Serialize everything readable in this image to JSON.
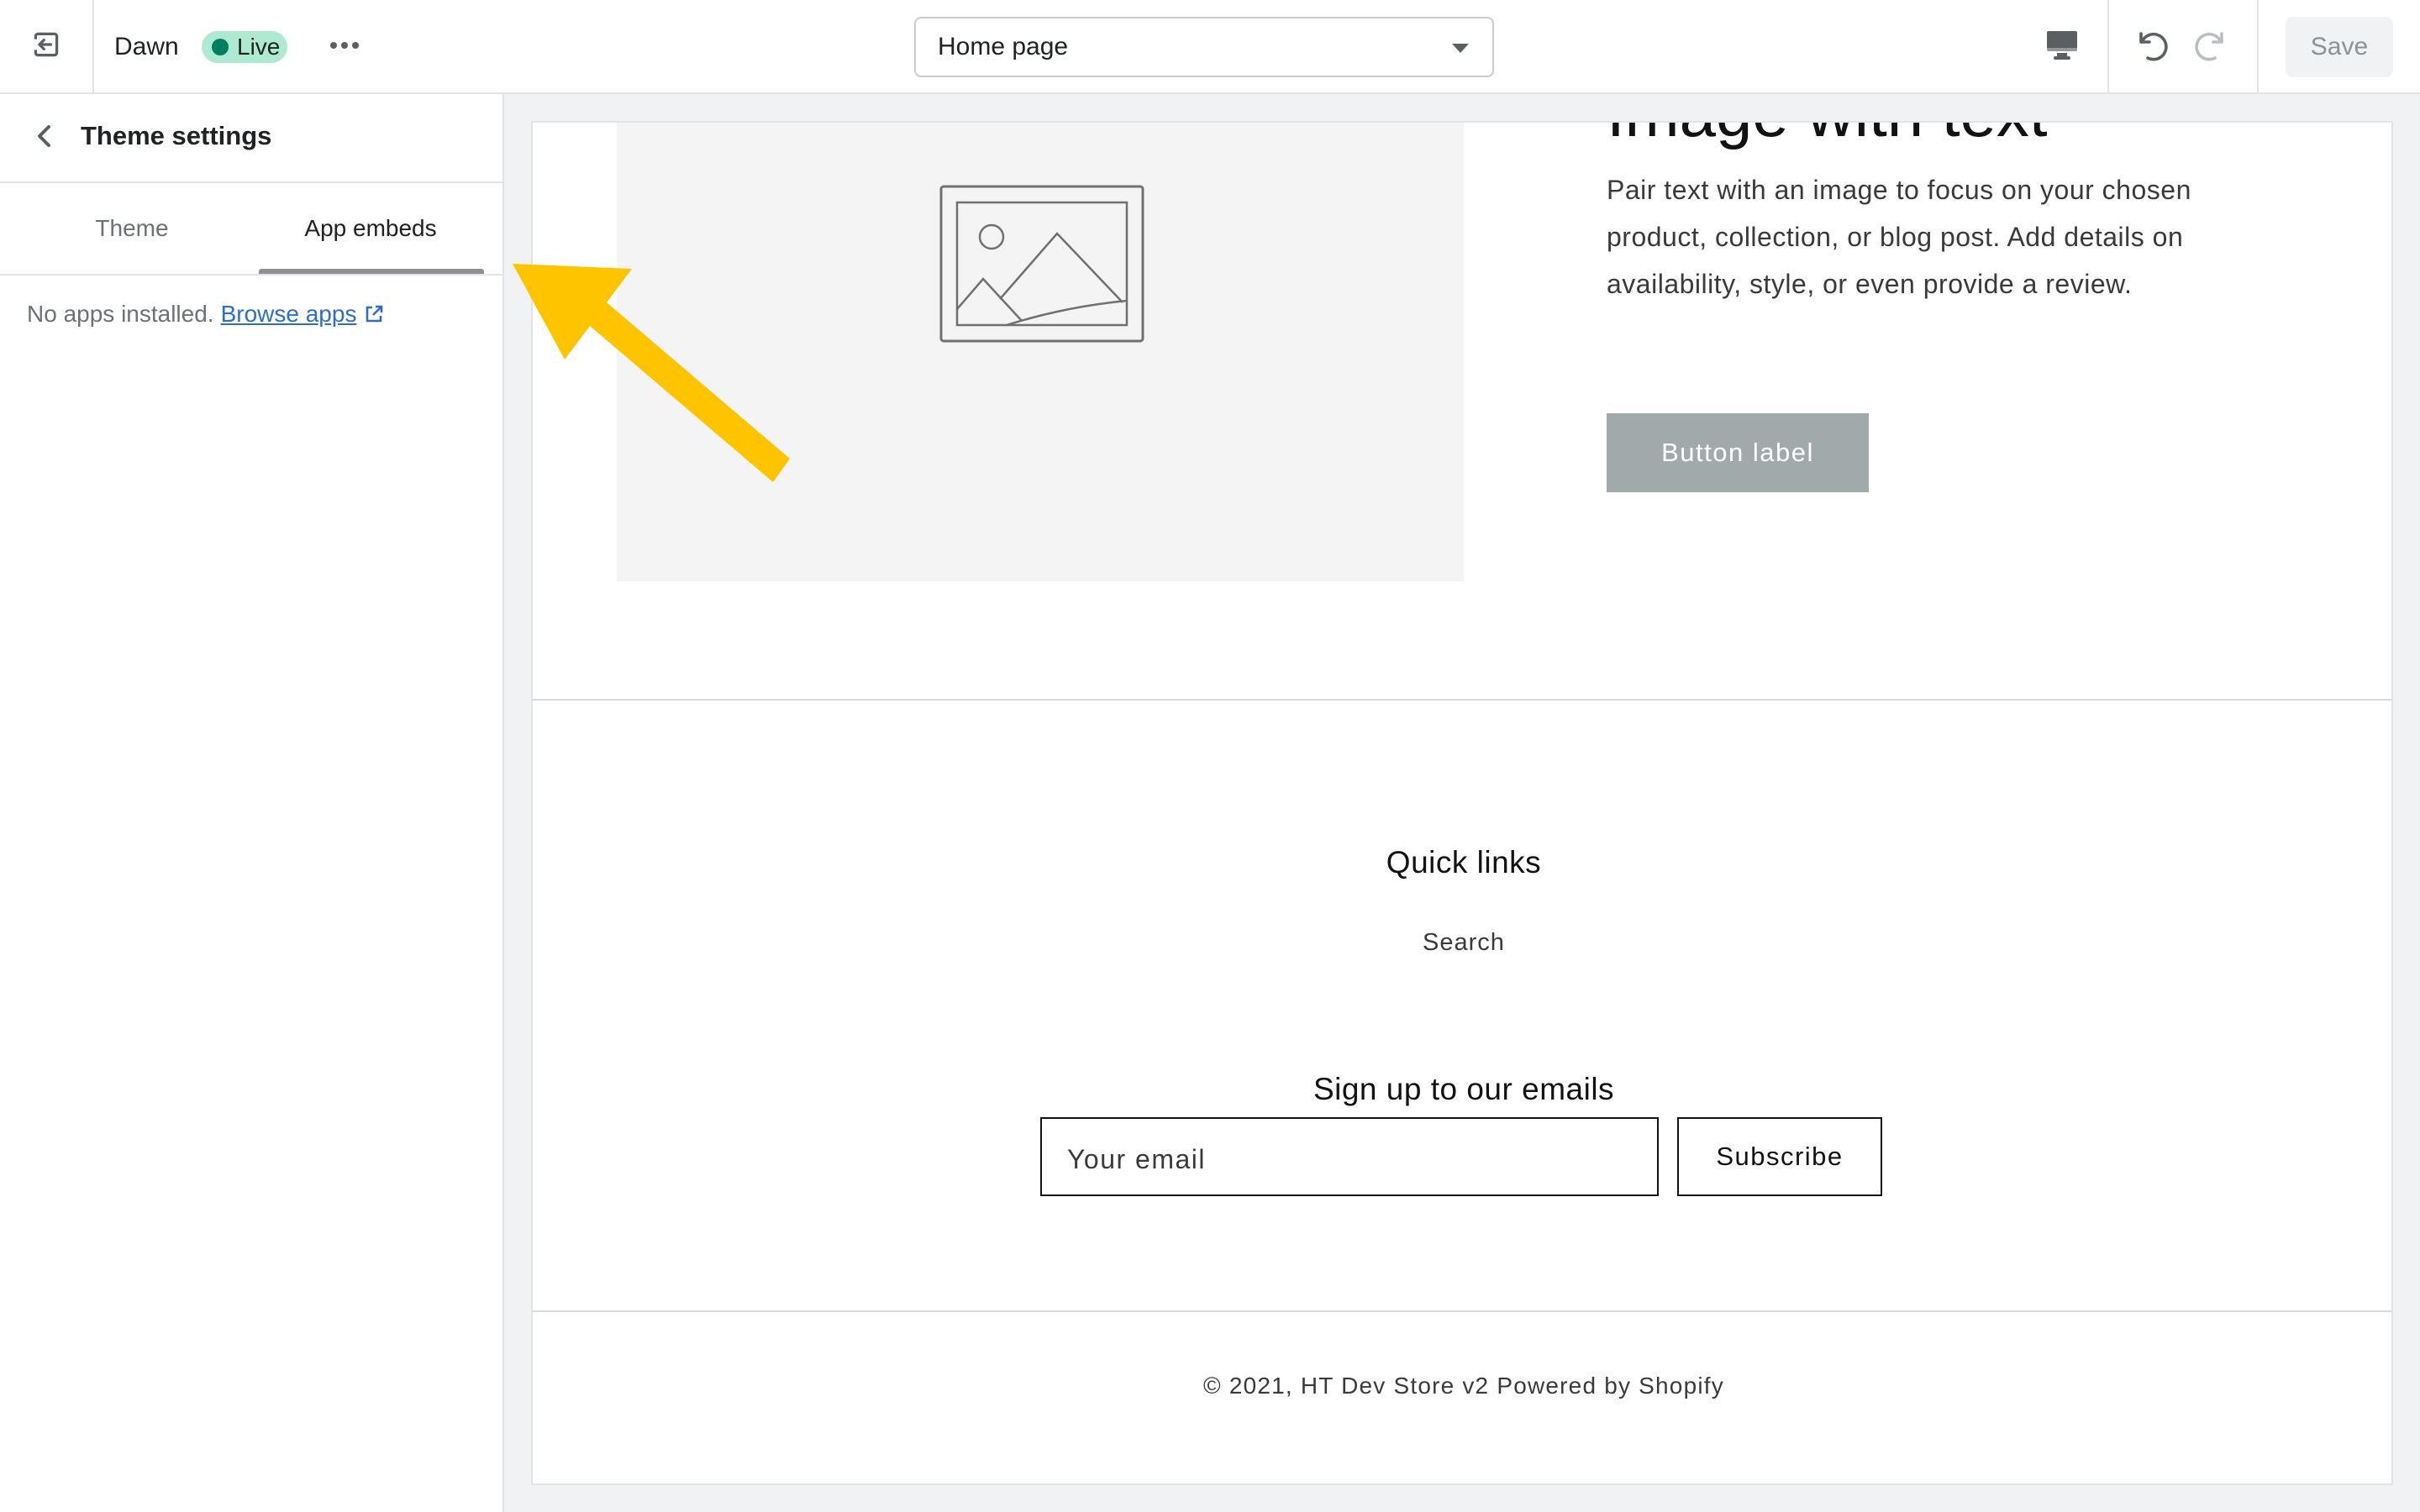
{
  "topbar": {
    "theme_name": "Dawn",
    "status_badge": "Live",
    "page_selector": "Home page",
    "save_label": "Save",
    "icons": {
      "exit": "exit-icon",
      "more": "more-horizontal-icon",
      "device": "desktop-icon",
      "undo": "undo-icon",
      "redo": "redo-icon",
      "caret": "caret-down-icon"
    }
  },
  "sidebar": {
    "title": "Theme settings",
    "tabs": [
      {
        "label": "Theme",
        "active": false
      },
      {
        "label": "App embeds",
        "active": true
      }
    ],
    "empty_text": "No apps installed.",
    "browse_link": "Browse apps"
  },
  "preview": {
    "image_with_text": {
      "heading": "Image with text",
      "body": "Pair text with an image to focus on your chosen product, collection, or blog post. Add details on availability, style, or even provide a review.",
      "button": "Button label"
    },
    "footer": {
      "quick_links_title": "Quick links",
      "links": [
        "Search"
      ],
      "newsletter_title": "Sign up to our emails",
      "email_placeholder": "Your email",
      "subscribe_label": "Subscribe",
      "copyright": "© 2021, HT Dev Store v2 Powered by Shopify"
    }
  },
  "colors": {
    "live_badge": "#aee9d1",
    "live_dot": "#007f5f",
    "link": "#2c6ecb",
    "arrow": "#ffc400",
    "button_bg": "#a1aaab"
  }
}
